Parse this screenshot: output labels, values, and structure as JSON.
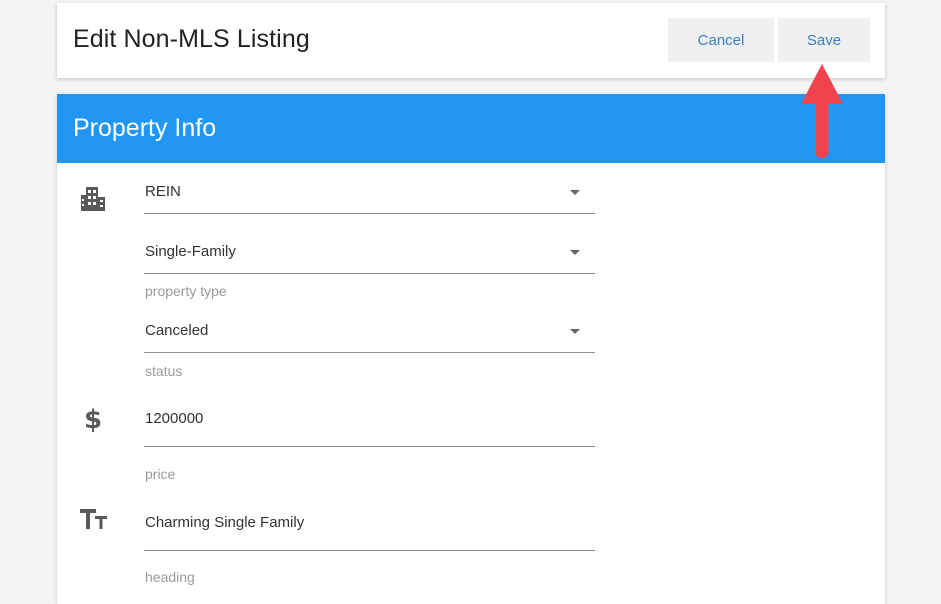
{
  "header": {
    "title": "Edit Non-MLS Listing",
    "cancel_label": "Cancel",
    "save_label": "Save"
  },
  "section": {
    "title": "Property Info"
  },
  "fields": {
    "mls": {
      "value": "REIN",
      "icon": "building-icon"
    },
    "property_type": {
      "value": "Single-Family",
      "helper": "property type"
    },
    "status": {
      "value": "Canceled",
      "helper": "status"
    },
    "price": {
      "value": "1200000",
      "helper": "price",
      "icon": "dollar-icon"
    },
    "heading": {
      "value": "Charming Single Family",
      "helper": "heading",
      "icon": "text-size-icon"
    }
  },
  "colors": {
    "section_header_bg": "#2196f3",
    "button_text": "#3a7fc1",
    "annotation_arrow": "#f0434e"
  }
}
